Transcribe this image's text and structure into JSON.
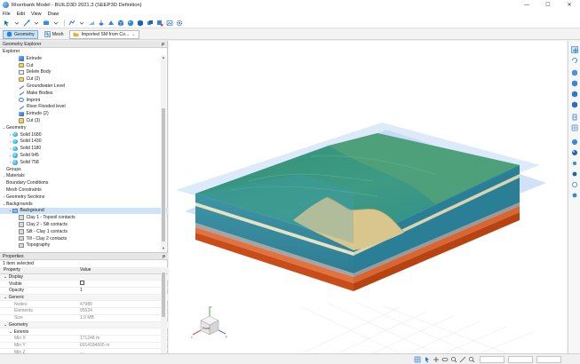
{
  "window": {
    "title": "Riverbank Model - BUILD3D 2021.3 (SEEP3D Definition)",
    "minimize": "—",
    "maximize": "☐",
    "close": "✕"
  },
  "menu": [
    "File",
    "Edit",
    "View",
    "Draw"
  ],
  "modes": {
    "geometry": "Geometry",
    "mesh": "Mesh",
    "dropdown": "Imported SM from Co..."
  },
  "geometry_explorer": {
    "title": "Geometry Explorer",
    "pin": "ᵽ",
    "subtitle": "Explorer",
    "tree": [
      {
        "label": "Extrude",
        "icon": "ext",
        "indent": 2,
        "toggle": ""
      },
      {
        "label": "Cut",
        "icon": "cut",
        "indent": 2,
        "toggle": ""
      },
      {
        "label": "Delete Body",
        "icon": "del",
        "indent": 2,
        "toggle": ""
      },
      {
        "label": "Cut (2)",
        "icon": "cut",
        "indent": 2,
        "toggle": ""
      },
      {
        "label": "Groundwater Level",
        "icon": "line",
        "indent": 2,
        "toggle": ""
      },
      {
        "label": "Make Bodies",
        "icon": "line",
        "indent": 2,
        "toggle": ""
      },
      {
        "label": "Imprint",
        "icon": "imp",
        "indent": 2,
        "toggle": ""
      },
      {
        "label": "River Flooded level",
        "icon": "line",
        "indent": 2,
        "toggle": ""
      },
      {
        "label": "Extrude (2)",
        "icon": "ext",
        "indent": 2,
        "toggle": ""
      },
      {
        "label": "Cut (3)",
        "icon": "cut",
        "indent": 2,
        "toggle": ""
      },
      {
        "label": "Geometry",
        "icon": "",
        "indent": 0,
        "toggle": "v"
      },
      {
        "label": "Solid 1680",
        "icon": "sphere",
        "indent": 1,
        "toggle": ">"
      },
      {
        "label": "Solid 1430",
        "icon": "sphere",
        "indent": 1,
        "toggle": ">"
      },
      {
        "label": "Solid 1180",
        "icon": "sphere",
        "indent": 1,
        "toggle": ">"
      },
      {
        "label": "Solid 945",
        "icon": "sphere",
        "indent": 1,
        "toggle": ">"
      },
      {
        "label": "Solid 758",
        "icon": "sphere",
        "indent": 1,
        "toggle": ">"
      },
      {
        "label": "Groups",
        "icon": "",
        "indent": 0,
        "toggle": ""
      },
      {
        "label": "Materials",
        "icon": "",
        "indent": 0,
        "toggle": ">"
      },
      {
        "label": "Boundary Conditions",
        "icon": "",
        "indent": 0,
        "toggle": ""
      },
      {
        "label": "Mesh Constraints",
        "icon": "",
        "indent": 0,
        "toggle": ""
      },
      {
        "label": "Geometry Sections",
        "icon": "",
        "indent": 0,
        "toggle": ">"
      },
      {
        "label": "Backgrounds",
        "icon": "",
        "indent": 0,
        "toggle": "v"
      },
      {
        "label": "Background",
        "icon": "layer",
        "indent": 1,
        "toggle": "v",
        "selected": true
      },
      {
        "label": "Clay 1 - Topsoil contacts",
        "icon": "box",
        "indent": 2,
        "toggle": ""
      },
      {
        "label": "Clay 2 - Silt contacts",
        "icon": "box",
        "indent": 2,
        "toggle": ""
      },
      {
        "label": "Silt - Clay 1 contacts",
        "icon": "box",
        "indent": 2,
        "toggle": ""
      },
      {
        "label": "Till - Clay 2 contacts",
        "icon": "box",
        "indent": 2,
        "toggle": ""
      },
      {
        "label": "Topography",
        "icon": "box",
        "indent": 2,
        "toggle": ""
      }
    ]
  },
  "properties": {
    "title": "Properties",
    "pin": "ᵽ",
    "selection": "1 item selected",
    "col_property": "Property",
    "col_value": "Value",
    "rows": [
      {
        "name": "Display",
        "value": "",
        "kind": "cat",
        "toggle": "v"
      },
      {
        "name": "Visible",
        "value": "",
        "kind": "sub",
        "check": true
      },
      {
        "name": "Opacity",
        "value": "1",
        "kind": "sub"
      },
      {
        "name": "Generic",
        "value": "",
        "kind": "cat",
        "toggle": "v"
      },
      {
        "name": "Nodes",
        "value": "47980",
        "kind": "dimsub"
      },
      {
        "name": "Elements",
        "value": "95624",
        "kind": "dimsub"
      },
      {
        "name": "Size",
        "value": "1.9 MB",
        "kind": "dimsub"
      },
      {
        "name": "Geometry",
        "value": "",
        "kind": "cat",
        "toggle": "v"
      },
      {
        "name": "Extents",
        "value": "",
        "kind": "sub",
        "toggle": "v"
      },
      {
        "name": "Min X",
        "value": "171248 m",
        "kind": "dimsub"
      },
      {
        "name": "Min Y",
        "value": "6914184605 m",
        "kind": "dimsub"
      },
      {
        "name": "Min Z",
        "value": "...",
        "kind": "dimsub"
      }
    ]
  },
  "viewcube": {
    "front": "Front",
    "axis_x": "x",
    "axis_y": "y",
    "axis_z": "z"
  },
  "colors": {
    "accent": "#1a73c7",
    "selected_bg": "#cde3f7",
    "teal": "#2e8e9a",
    "terrain_green": "#3f9a82",
    "sand": "#d9c68c",
    "orange_layer": "#d2571f"
  }
}
